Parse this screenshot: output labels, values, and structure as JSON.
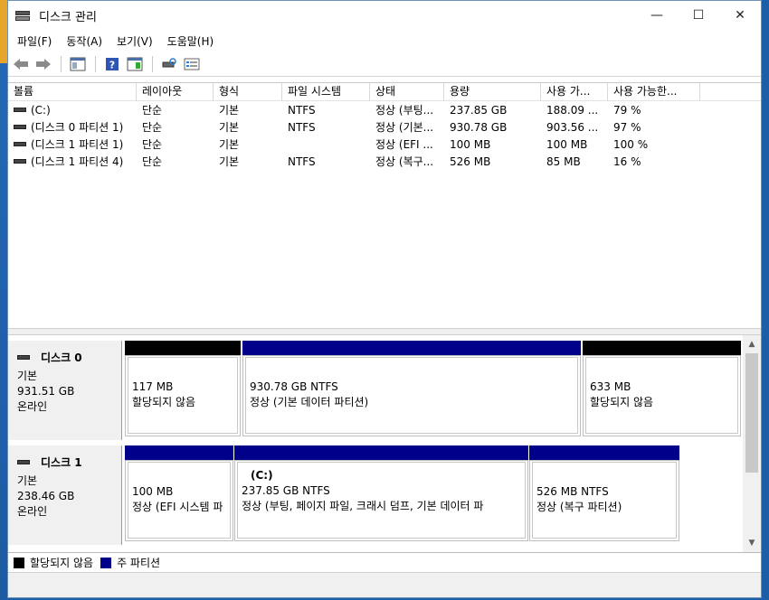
{
  "window": {
    "title": "디스크 관리",
    "controls": {
      "minimize": "—",
      "maximize": "☐",
      "close": "✕"
    }
  },
  "menu": [
    "파일(F)",
    "동작(A)",
    "보기(V)",
    "도움말(H)"
  ],
  "toolbar": {
    "icons": [
      "back-icon",
      "forward-icon",
      "show-hide-console-tree-icon",
      "help-icon",
      "properties-icon",
      "connect-disk-icon",
      "list-icon"
    ]
  },
  "volume_list": {
    "columns": [
      "볼륨",
      "레이아웃",
      "형식",
      "파일 시스템",
      "상태",
      "용량",
      "사용 가...",
      "사용 가능한..."
    ],
    "rows": [
      [
        "(C:)",
        "단순",
        "기본",
        "NTFS",
        "정상 (부팅...",
        "237.85 GB",
        "188.09 ...",
        "79 %"
      ],
      [
        "(디스크 0 파티션 1)",
        "단순",
        "기본",
        "NTFS",
        "정상 (기본...",
        "930.78 GB",
        "903.56 ...",
        "97 %"
      ],
      [
        "(디스크 1 파티션 1)",
        "단순",
        "기본",
        "",
        "정상 (EFI ...",
        "100 MB",
        "100 MB",
        "100 %"
      ],
      [
        "(디스크 1 파티션 4)",
        "단순",
        "기본",
        "NTFS",
        "정상 (복구...",
        "526 MB",
        "85 MB",
        "16 %"
      ]
    ]
  },
  "disks": [
    {
      "name": "디스크 0",
      "type": "기본",
      "size": "931.51 GB",
      "status": "온라인",
      "partitions": [
        {
          "kind": "unallocated",
          "title": "",
          "size": "117 MB",
          "desc": "할당되지 않음"
        },
        {
          "kind": "primary",
          "title": "",
          "size": "930.78 GB NTFS",
          "desc": "정상 (기본 데이터 파티션)"
        },
        {
          "kind": "unallocated",
          "title": "",
          "size": "633 MB",
          "desc": "할당되지 않음"
        }
      ]
    },
    {
      "name": "디스크 1",
      "type": "기본",
      "size": "238.46 GB",
      "status": "온라인",
      "partitions": [
        {
          "kind": "primary",
          "title": "",
          "size": "100 MB",
          "desc": "정상 (EFI 시스템 파"
        },
        {
          "kind": "primary",
          "title": "(C:)",
          "size": "237.85 GB NTFS",
          "desc": "정상 (부팅, 페이지 파일, 크래시 덤프, 기본 데이터 파"
        },
        {
          "kind": "primary",
          "title": "",
          "size": "526 MB NTFS",
          "desc": "정상 (복구 파티션)"
        }
      ]
    }
  ],
  "legend": [
    {
      "label": "할당되지 않음",
      "color": "#000000"
    },
    {
      "label": "주 파티션",
      "color": "#00008b"
    }
  ],
  "colors": {
    "unallocated": "#000000",
    "primary": "#00008b"
  }
}
